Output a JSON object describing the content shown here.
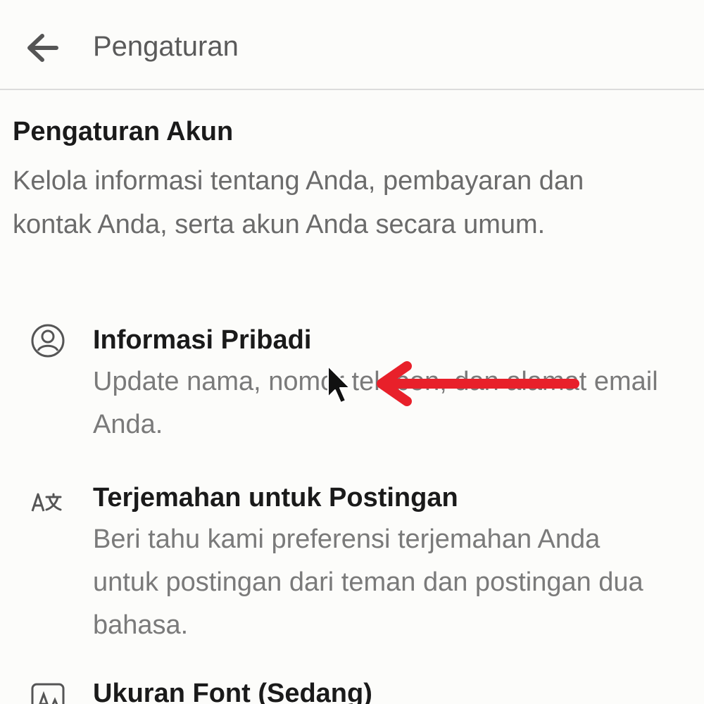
{
  "header": {
    "title": "Pengaturan"
  },
  "section": {
    "title": "Pengaturan Akun",
    "description": "Kelola informasi tentang Anda, pembayaran dan kontak Anda, serta akun Anda secara umum."
  },
  "items": [
    {
      "title": "Informasi Pribadi",
      "description": "Update nama, nomor telepon, dan alamat email Anda.",
      "icon": "person-circle-icon"
    },
    {
      "title": "Terjemahan untuk Postingan",
      "description": "Beri tahu kami preferensi terjemahan Anda untuk postingan dari teman dan postingan dua bahasa.",
      "icon": "translate-icon"
    },
    {
      "title": "Ukuran Font (Sedang)",
      "description": "",
      "icon": "font-size-icon"
    }
  ],
  "colors": {
    "annotation": "#e8202a",
    "background": "#fcfcfa",
    "secondary_text": "#7a7a7a"
  }
}
